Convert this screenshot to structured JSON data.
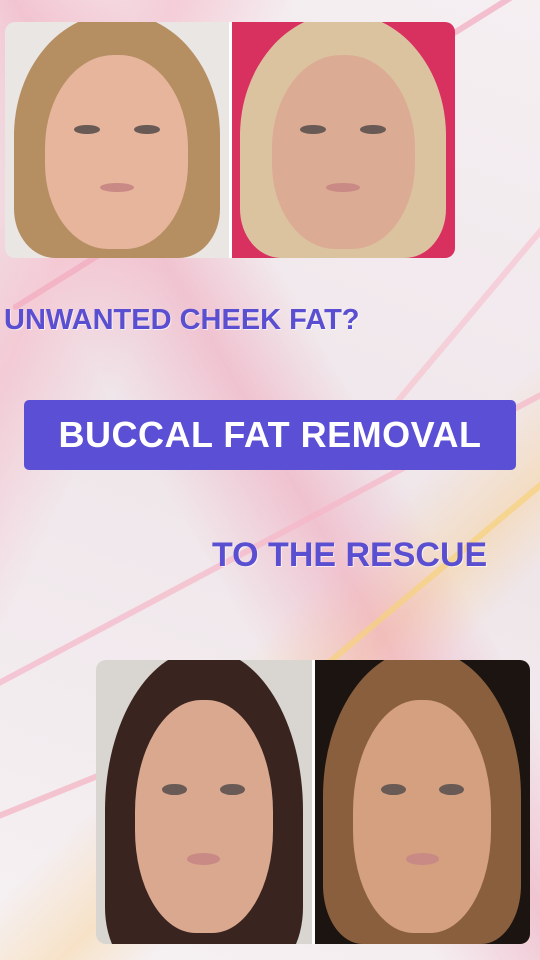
{
  "captions": {
    "line1": "UNWANTED CHEEK FAT?",
    "banner": "BUCCAL FAT REMOVAL",
    "line3": "TO THE RESCUE"
  },
  "colors": {
    "caption": "#5b4fd1",
    "banner_bg": "#5b4fd6",
    "banner_text": "#ffffff"
  }
}
